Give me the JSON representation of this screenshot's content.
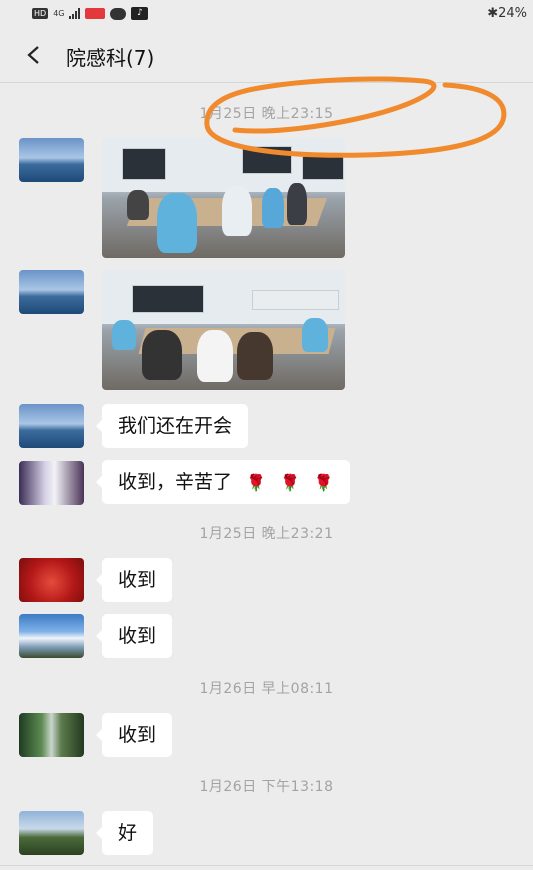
{
  "status": {
    "left_badges": [
      "HD",
      "4G"
    ],
    "right_text": "✱24%"
  },
  "header": {
    "back_icon": "chevron-left-icon",
    "title": "院感科(7)"
  },
  "messages": {
    "ts1": "1月25日 晚上23:15",
    "msg3": "我们还在开会",
    "msg4": "收到，辛苦了",
    "roses": [
      "🌹",
      "🌹",
      "🌹"
    ],
    "ts2": "1月25日 晚上23:21",
    "msg5": "收到",
    "msg6": "收到",
    "ts3": "1月26日 早上08:11",
    "msg7": "收到",
    "ts4": "1月26日 下午13:18",
    "msg8": "好"
  },
  "colors": {
    "background": "#ececec",
    "bubble": "#ffffff",
    "timestamp": "#a3a3a3",
    "annotation": "#f08a2c"
  }
}
